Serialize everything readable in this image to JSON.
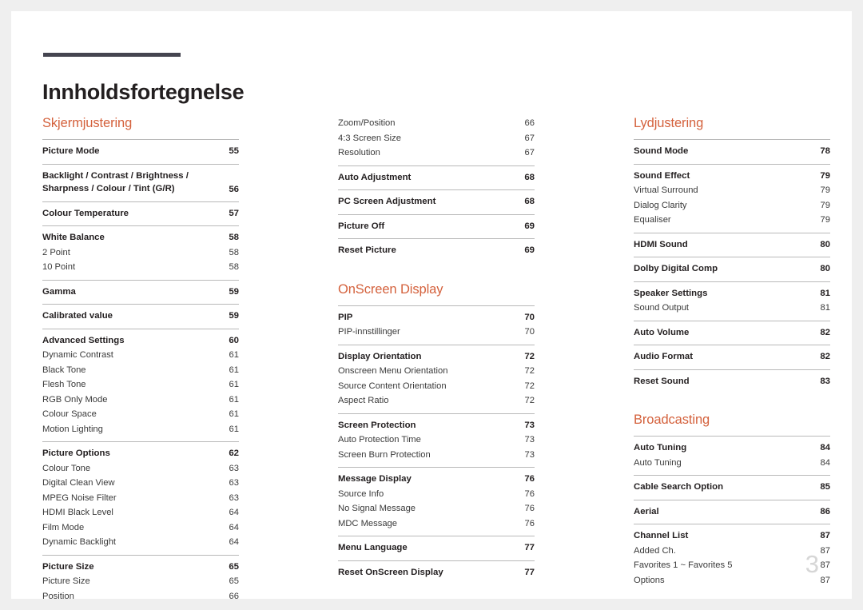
{
  "document": {
    "title": "Innholdsfortegnelse",
    "folio": "3",
    "accent_color": "#d4613c",
    "rule_color": "#454550"
  },
  "columns": [
    {
      "sections": [
        {
          "heading": "Skjermjustering",
          "groups": [
            {
              "entries": [
                {
                  "label": "Picture Mode",
                  "page": "55",
                  "level": "main"
                }
              ]
            },
            {
              "entries": [
                {
                  "label": "Backlight / Contrast / Brightness / Sharpness / Colour / Tint (G/R)",
                  "page": "56",
                  "level": "main",
                  "wrap": true
                }
              ]
            },
            {
              "entries": [
                {
                  "label": "Colour Temperature",
                  "page": "57",
                  "level": "main"
                }
              ]
            },
            {
              "entries": [
                {
                  "label": "White Balance",
                  "page": "58",
                  "level": "main"
                },
                {
                  "label": "2 Point",
                  "page": "58",
                  "level": "sub"
                },
                {
                  "label": "10 Point",
                  "page": "58",
                  "level": "sub"
                }
              ]
            },
            {
              "entries": [
                {
                  "label": "Gamma",
                  "page": "59",
                  "level": "main"
                }
              ]
            },
            {
              "entries": [
                {
                  "label": "Calibrated value",
                  "page": "59",
                  "level": "main"
                }
              ]
            },
            {
              "entries": [
                {
                  "label": "Advanced Settings",
                  "page": "60",
                  "level": "main"
                },
                {
                  "label": "Dynamic Contrast",
                  "page": "61",
                  "level": "sub"
                },
                {
                  "label": "Black Tone",
                  "page": "61",
                  "level": "sub"
                },
                {
                  "label": "Flesh Tone",
                  "page": "61",
                  "level": "sub"
                },
                {
                  "label": "RGB Only Mode",
                  "page": "61",
                  "level": "sub"
                },
                {
                  "label": "Colour Space",
                  "page": "61",
                  "level": "sub"
                },
                {
                  "label": "Motion Lighting",
                  "page": "61",
                  "level": "sub"
                }
              ]
            },
            {
              "entries": [
                {
                  "label": "Picture Options",
                  "page": "62",
                  "level": "main"
                },
                {
                  "label": "Colour Tone",
                  "page": "63",
                  "level": "sub"
                },
                {
                  "label": "Digital Clean View",
                  "page": "63",
                  "level": "sub"
                },
                {
                  "label": "MPEG Noise Filter",
                  "page": "63",
                  "level": "sub"
                },
                {
                  "label": "HDMI Black Level",
                  "page": "64",
                  "level": "sub"
                },
                {
                  "label": "Film Mode",
                  "page": "64",
                  "level": "sub"
                },
                {
                  "label": "Dynamic Backlight",
                  "page": "64",
                  "level": "sub"
                }
              ]
            },
            {
              "entries": [
                {
                  "label": "Picture Size",
                  "page": "65",
                  "level": "main"
                },
                {
                  "label": "Picture Size",
                  "page": "65",
                  "level": "sub"
                },
                {
                  "label": "Position",
                  "page": "66",
                  "level": "sub"
                }
              ]
            }
          ]
        }
      ]
    },
    {
      "sections": [
        {
          "heading": "",
          "groups": [
            {
              "no_rule": true,
              "entries": [
                {
                  "label": "Zoom/Position",
                  "page": "66",
                  "level": "sub"
                },
                {
                  "label": "4:3 Screen Size",
                  "page": "67",
                  "level": "sub"
                },
                {
                  "label": "Resolution",
                  "page": "67",
                  "level": "sub"
                }
              ]
            },
            {
              "entries": [
                {
                  "label": "Auto Adjustment",
                  "page": "68",
                  "level": "main"
                }
              ]
            },
            {
              "entries": [
                {
                  "label": "PC Screen Adjustment",
                  "page": "68",
                  "level": "main"
                }
              ]
            },
            {
              "entries": [
                {
                  "label": "Picture Off",
                  "page": "69",
                  "level": "main"
                }
              ]
            },
            {
              "entries": [
                {
                  "label": "Reset Picture",
                  "page": "69",
                  "level": "main"
                }
              ]
            }
          ]
        },
        {
          "heading": "OnScreen Display",
          "groups": [
            {
              "entries": [
                {
                  "label": "PIP",
                  "page": "70",
                  "level": "main"
                },
                {
                  "label": "PIP-innstillinger",
                  "page": "70",
                  "level": "sub"
                }
              ]
            },
            {
              "entries": [
                {
                  "label": "Display Orientation",
                  "page": "72",
                  "level": "main"
                },
                {
                  "label": "Onscreen Menu Orientation",
                  "page": "72",
                  "level": "sub"
                },
                {
                  "label": "Source Content Orientation",
                  "page": "72",
                  "level": "sub"
                },
                {
                  "label": "Aspect Ratio",
                  "page": "72",
                  "level": "sub"
                }
              ]
            },
            {
              "entries": [
                {
                  "label": "Screen Protection",
                  "page": "73",
                  "level": "main"
                },
                {
                  "label": "Auto Protection Time",
                  "page": "73",
                  "level": "sub"
                },
                {
                  "label": "Screen Burn Protection",
                  "page": "73",
                  "level": "sub"
                }
              ]
            },
            {
              "entries": [
                {
                  "label": "Message Display",
                  "page": "76",
                  "level": "main"
                },
                {
                  "label": "Source Info",
                  "page": "76",
                  "level": "sub"
                },
                {
                  "label": "No Signal Message",
                  "page": "76",
                  "level": "sub"
                },
                {
                  "label": "MDC Message",
                  "page": "76",
                  "level": "sub"
                }
              ]
            },
            {
              "entries": [
                {
                  "label": "Menu Language",
                  "page": "77",
                  "level": "main"
                }
              ]
            },
            {
              "entries": [
                {
                  "label": "Reset OnScreen Display",
                  "page": "77",
                  "level": "main"
                }
              ]
            }
          ]
        }
      ]
    },
    {
      "sections": [
        {
          "heading": "Lydjustering",
          "groups": [
            {
              "entries": [
                {
                  "label": "Sound Mode",
                  "page": "78",
                  "level": "main"
                }
              ]
            },
            {
              "entries": [
                {
                  "label": "Sound Effect",
                  "page": "79",
                  "level": "main"
                },
                {
                  "label": "Virtual Surround",
                  "page": "79",
                  "level": "sub"
                },
                {
                  "label": "Dialog Clarity",
                  "page": "79",
                  "level": "sub"
                },
                {
                  "label": "Equaliser",
                  "page": "79",
                  "level": "sub"
                }
              ]
            },
            {
              "entries": [
                {
                  "label": "HDMI Sound",
                  "page": "80",
                  "level": "main"
                }
              ]
            },
            {
              "entries": [
                {
                  "label": "Dolby Digital Comp",
                  "page": "80",
                  "level": "main"
                }
              ]
            },
            {
              "entries": [
                {
                  "label": "Speaker Settings",
                  "page": "81",
                  "level": "main"
                },
                {
                  "label": "Sound Output",
                  "page": "81",
                  "level": "sub"
                }
              ]
            },
            {
              "entries": [
                {
                  "label": "Auto Volume",
                  "page": "82",
                  "level": "main"
                }
              ]
            },
            {
              "entries": [
                {
                  "label": "Audio Format",
                  "page": "82",
                  "level": "main"
                }
              ]
            },
            {
              "entries": [
                {
                  "label": "Reset Sound",
                  "page": "83",
                  "level": "main"
                }
              ]
            }
          ]
        },
        {
          "heading": "Broadcasting",
          "groups": [
            {
              "entries": [
                {
                  "label": "Auto Tuning",
                  "page": "84",
                  "level": "main"
                },
                {
                  "label": "Auto Tuning",
                  "page": "84",
                  "level": "sub"
                }
              ]
            },
            {
              "entries": [
                {
                  "label": "Cable Search Option",
                  "page": "85",
                  "level": "main"
                }
              ]
            },
            {
              "entries": [
                {
                  "label": "Aerial",
                  "page": "86",
                  "level": "main"
                }
              ]
            },
            {
              "entries": [
                {
                  "label": "Channel List",
                  "page": "87",
                  "level": "main"
                },
                {
                  "label": "Added Ch.",
                  "page": "87",
                  "level": "sub"
                },
                {
                  "label": "Favorites 1 ~ Favorites 5",
                  "page": "87",
                  "level": "sub"
                },
                {
                  "label": "Options",
                  "page": "87",
                  "level": "sub"
                }
              ]
            }
          ]
        }
      ]
    }
  ]
}
